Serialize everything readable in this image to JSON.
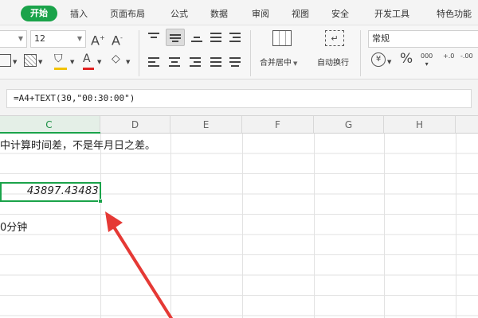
{
  "menu": {
    "active": "开始",
    "items": [
      "插入",
      "页面布局",
      "公式",
      "数据",
      "审阅",
      "视图",
      "安全",
      "开发工具",
      "特色功能"
    ]
  },
  "ribbon": {
    "font_size": "12",
    "merge_label": "合并居中",
    "wrap_label": "自动换行",
    "number_format": "常规",
    "percent": "%",
    "thousands": "000",
    "inc_decimal": "+.0",
    "dec_decimal": "-.00",
    "font_color": "#e02020",
    "fill_color": "#f2c200"
  },
  "formula": "=A4+TEXT(30,\"00:30:00\")",
  "columns": [
    "C",
    "D",
    "E",
    "F",
    "G",
    "H"
  ],
  "cells": {
    "row1": "中计算时间差，不是年月日之差。",
    "value": "43897.43483",
    "row4": "0分钟"
  },
  "accent": "#1aa34a",
  "arrow_color": "#e53935"
}
